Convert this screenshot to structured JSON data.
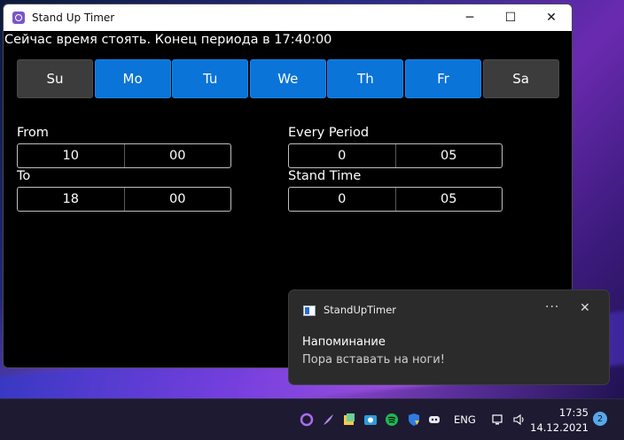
{
  "window": {
    "title": "Stand Up Timer",
    "controls": {
      "minimize": "─",
      "maximize": "☐",
      "close": "✕"
    }
  },
  "status_message": "Сейчас время стоять. Конец периода в 17:40:00",
  "days": [
    {
      "label": "Su",
      "selected": false
    },
    {
      "label": "Mo",
      "selected": true
    },
    {
      "label": "Tu",
      "selected": true
    },
    {
      "label": "We",
      "selected": true
    },
    {
      "label": "Th",
      "selected": true
    },
    {
      "label": "Fr",
      "selected": true
    },
    {
      "label": "Sa",
      "selected": false
    }
  ],
  "from": {
    "label": "From",
    "hours": "10",
    "minutes": "00"
  },
  "to": {
    "label": "To",
    "hours": "18",
    "minutes": "00"
  },
  "every_period": {
    "label": "Every Period",
    "hours": "0",
    "minutes": "05"
  },
  "stand_time": {
    "label": "Stand Time",
    "hours": "0",
    "minutes": "05"
  },
  "notification": {
    "app_name": "StandUpTimer",
    "more": "···",
    "close": "✕",
    "title": "Напоминание",
    "body": "Пора вставать на ноги!"
  },
  "taskbar": {
    "language": "ENG",
    "time": "17:35",
    "date": "14.12.2021",
    "notification_count": "2"
  },
  "colors": {
    "selected_day": "#0a74d8",
    "unselected_day": "#3c3c3c",
    "window_bg": "#000000",
    "toast_bg": "#2b2b2b"
  }
}
